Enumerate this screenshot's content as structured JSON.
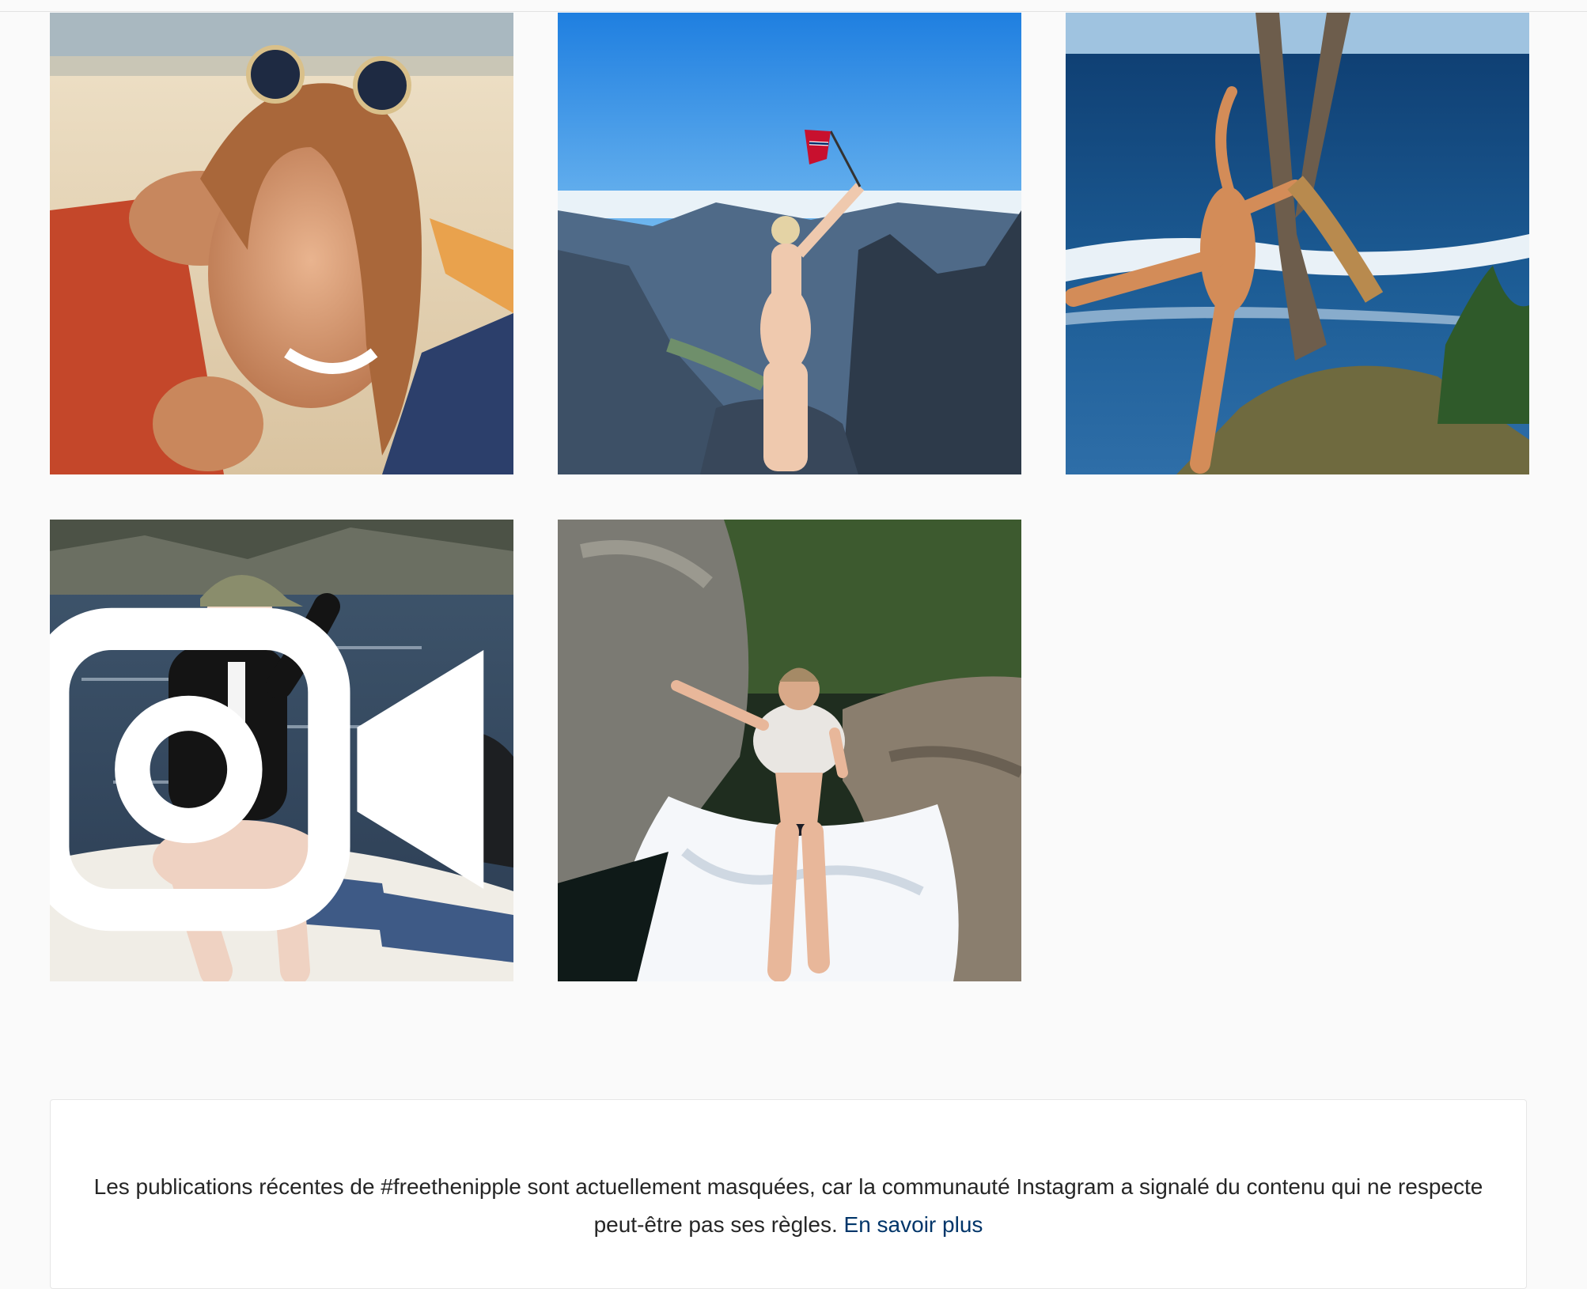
{
  "grid": {
    "posts": [
      {
        "alt": "",
        "type": "photo"
      },
      {
        "alt": "",
        "type": "photo"
      },
      {
        "alt": "",
        "type": "photo"
      },
      {
        "alt": "",
        "type": "video",
        "icon": "video-camera-icon"
      },
      {
        "alt": "",
        "type": "photo"
      }
    ]
  },
  "notice": {
    "text": "Les publications récentes de #freethenipple sont actuellement masquées, car la communauté Instagram a signalé du contenu qui ne respecte peut-être pas ses règles.",
    "link_label": "En savoir plus"
  },
  "colors": {
    "background": "#fafafa",
    "card": "#ffffff",
    "text": "#262626",
    "link": "#003569"
  }
}
